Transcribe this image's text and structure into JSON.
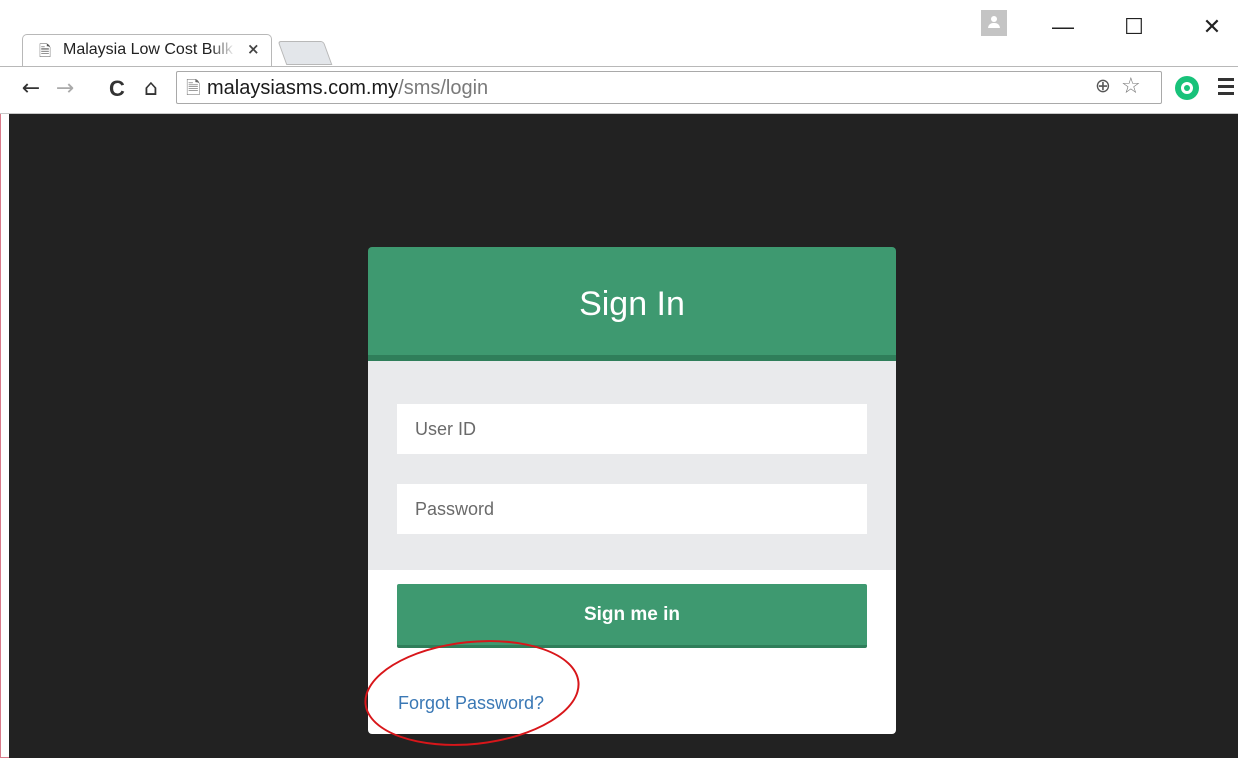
{
  "browser": {
    "tab_title": "Malaysia Low Cost Bulk SMS",
    "tab_close": "×",
    "url_host": "malaysiasms.com.my",
    "url_path": "/sms/login",
    "window": {
      "minimize": "—",
      "maximize": "☐",
      "close": "✕"
    },
    "nav": {
      "back": "←",
      "forward": "→",
      "reload": "C",
      "home": "⌂"
    }
  },
  "login": {
    "title": "Sign In",
    "user_placeholder": "User ID",
    "password_placeholder": "Password",
    "submit_label": "Sign me in",
    "forgot_label": "Forgot Password?"
  },
  "colors": {
    "accent": "#3e9970",
    "page_background": "#222222",
    "link": "#3a78b5",
    "annotation": "#d8161a"
  }
}
